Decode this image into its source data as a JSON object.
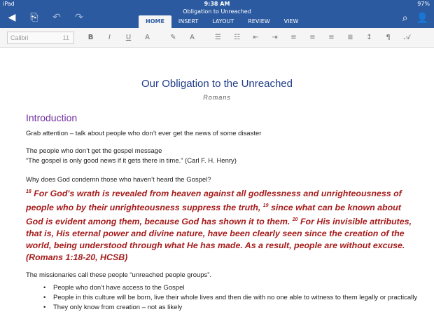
{
  "status": {
    "carrier": "iPad",
    "time": "9:38 AM",
    "right": "97%"
  },
  "doc_title": "Obligation to Unreached",
  "tabs": [
    "HOME",
    "INSERT",
    "LAYOUT",
    "REVIEW",
    "VIEW"
  ],
  "toolbar": {
    "font": "Calibri",
    "size": "11",
    "bold": "B",
    "italic": "I",
    "underline": "U",
    "text_effects": "A",
    "font_color": "A"
  },
  "document": {
    "title": "Our Obligation to the Unreached",
    "subtitle": "Romans",
    "intro_heading": "Introduction",
    "p1": "Grab attention – talk about people who don’t ever get the news of some disaster",
    "p2": "The people who don’t get the gospel message",
    "p3": "“The gospel is only good news if it gets there in time.” (Carl F. H. Henry)",
    "p4": "Why does God condemn those who haven’t heard the Gospel?",
    "scripture": {
      "v18": "18",
      "t18": " For God's wrath is revealed from heaven against all godlessness and unrighteousness of people who by their unrighteousness suppress the truth, ",
      "v19": "19",
      "t19": " since what can be known about God is evident among them, because God has shown it to them. ",
      "v20": "20",
      "t20": " For His invisible attributes, that is, His eternal power and divine nature, have been clearly seen since the creation of the world, being understood through what He has made. As a result, people are without excuse. (Romans 1:18-20, HCSB)"
    },
    "p5": "The missionaries call these people “unreached people groups”.",
    "bullets": [
      "People who don’t have access to the Gospel",
      "People in this culture will be born, live their whole lives and then die with no one able to witness to them legally or practically",
      "They only know from creation – not as likely"
    ]
  }
}
